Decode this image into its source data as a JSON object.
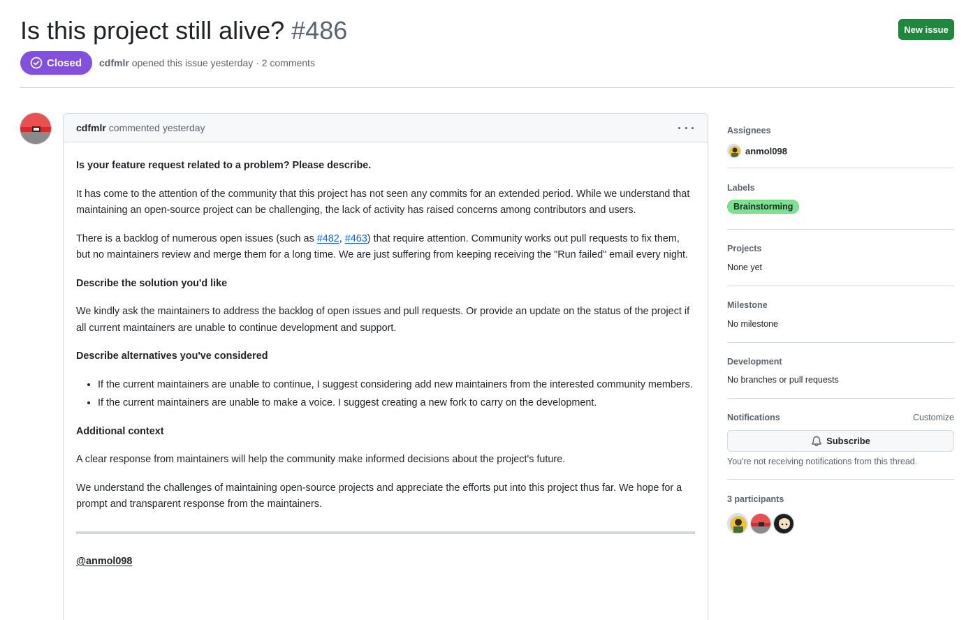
{
  "header": {
    "title": "Is this project still alive?",
    "number": "#486",
    "new_issue_label": "New issue",
    "state": "Closed",
    "author": "cdfmlr",
    "meta": "opened this issue yesterday · 2 comments"
  },
  "comment": {
    "author": "cdfmlr",
    "action": "commented yesterday",
    "heading1": "Is your feature request related to a problem? Please describe.",
    "para1": "It has come to the attention of the community that this project has not seen any commits for an extended period. While we understand that maintaining an open-source project can be challenging, the lack of activity has raised concerns among contributors and users.",
    "para2_a": "There is a backlog of numerous open issues (such as ",
    "link1": "#482",
    "para2_sep": ", ",
    "link2": "#463",
    "para2_b": ") that require attention. Community works out pull requests to fix them, but no maintainers review and merge them for a long time. We are just suffering from keeping receiving the \"Run failed\" email every night.",
    "heading2": "Describe the solution you'd like",
    "para3": "We kindly ask the maintainers to address the backlog of open issues and pull requests. Or provide an update on the status of the project if all current maintainers are unable to continue development and support.",
    "heading3": "Describe alternatives you've considered",
    "bullets": [
      "If the current maintainers are unable to continue, I suggest considering add new maintainers from the interested community members.",
      "If the current maintainers are unable to make a voice. I suggest creating a new fork to carry on the development."
    ],
    "heading4": "Additional context",
    "para4": "A clear response from maintainers will help the community make informed decisions about the project's future.",
    "para5": "We understand the challenges of maintaining open-source projects and appreciate the efforts put into this project thus far. We hope for a prompt and transparent response from the maintainers.",
    "mention": "@anmol098"
  },
  "sidebar": {
    "assignees_title": "Assignees",
    "assignee": "anmol098",
    "labels_title": "Labels",
    "label": "Brainstorming",
    "label_color": "#7be38f",
    "projects_title": "Projects",
    "projects_value": "None yet",
    "milestone_title": "Milestone",
    "milestone_value": "No milestone",
    "development_title": "Development",
    "development_value": "No branches or pull requests",
    "notifications_title": "Notifications",
    "customize_label": "Customize",
    "subscribe_label": "Subscribe",
    "notif_note": "You're not receiving notifications from this thread.",
    "participants_title": "3 participants"
  },
  "colors": {
    "closed": "#8250df",
    "primary_button": "#1f883d",
    "link": "#0969da"
  },
  "icons": [
    "closed-circle-icon",
    "kebab-icon",
    "bell-icon"
  ]
}
